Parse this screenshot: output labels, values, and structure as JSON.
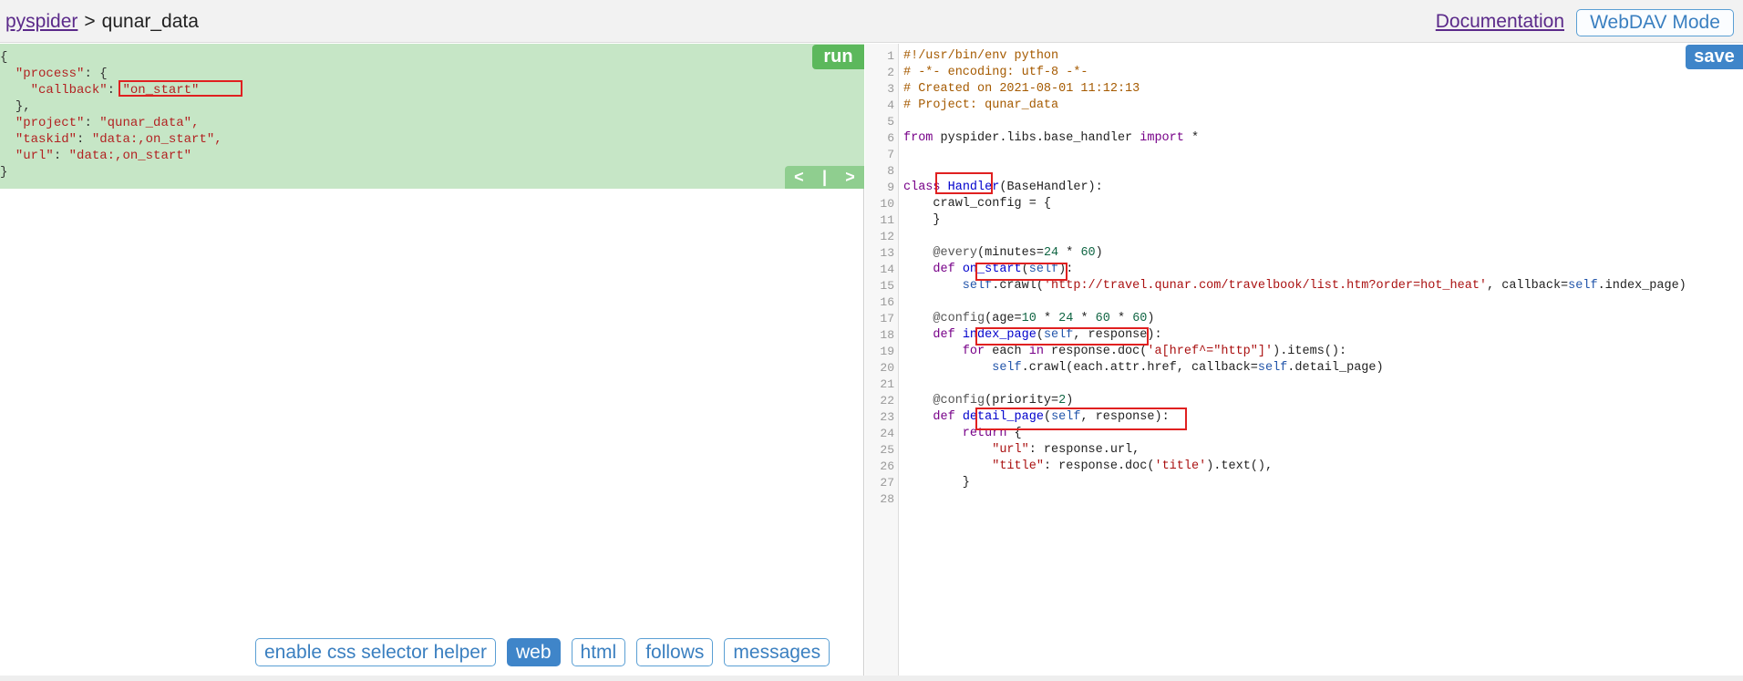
{
  "header": {
    "home_link": "pyspider",
    "separator": ">",
    "project_name": "qunar_data",
    "documentation_link": "Documentation",
    "webdav_button": "WebDAV Mode"
  },
  "task_panel": {
    "run_button": "run",
    "prev_label": "<",
    "divider_label": "|",
    "next_label": ">",
    "json": {
      "l1": "{",
      "l2_key": "\"process\"",
      "l2_rest": ": {",
      "l3_key": "\"callback\"",
      "l3_colon": ": ",
      "l3_value": "\"on_start\"",
      "l4": "},",
      "l5_key": "\"project\"",
      "l5_colon": ": ",
      "l5_value": "\"qunar_data\",",
      "l6_key": "\"taskid\"",
      "l6_colon": ": ",
      "l6_value": "\"data:,on_start\",",
      "l7_key": "\"url\"",
      "l7_colon": ": ",
      "l7_value": "\"data:,on_start\"",
      "l8": "}"
    }
  },
  "bottom_tabs": {
    "css_helper": "enable css selector helper",
    "web": "web",
    "html": "html",
    "follows": "follows",
    "messages": "messages"
  },
  "editor": {
    "save_button": "save",
    "line_numbers": [
      "1",
      "2",
      "3",
      "4",
      "5",
      "6",
      "7",
      "8",
      "9",
      "10",
      "11",
      "12",
      "13",
      "14",
      "15",
      "16",
      "17",
      "18",
      "19",
      "20",
      "21",
      "22",
      "23",
      "24",
      "25",
      "26",
      "27",
      "28"
    ],
    "code": {
      "l1": "#!/usr/bin/env python",
      "l2": "# -*- encoding: utf-8 -*-",
      "l3": "# Created on 2021-08-01 11:12:13",
      "l4": "# Project: qunar_data",
      "l6_from": "from",
      "l6_mod": " pyspider.libs.base_handler ",
      "l6_import": "import",
      "l6_star": " *",
      "l9_class": "class",
      "l9_name": "Handler",
      "l9_rest": "(BaseHandler):",
      "l10": "    crawl_config = {",
      "l11": "    }",
      "l13_dec": "    @every",
      "l13_a": "(minutes=",
      "l13_n1": "24",
      "l13_op": " * ",
      "l13_n2": "60",
      "l13_b": ")",
      "l14_def": "    def",
      "l14_name": "on_start",
      "l14_a": "(",
      "l14_self": "self",
      "l14_b": "):",
      "l15_self": "        self",
      "l15_a": ".crawl(",
      "l15_url": "'http://travel.qunar.com/travelbook/list.htm?order=hot_heat'",
      "l15_b": ", callback=",
      "l15_self2": "self",
      "l15_c": ".index_page)",
      "l17_dec": "    @config",
      "l17_a": "(age=",
      "l17_n1": "10",
      "l17_op1": " * ",
      "l17_n2": "24",
      "l17_op2": " * ",
      "l17_n3": "60",
      "l17_op3": " * ",
      "l17_n4": "60",
      "l17_b": ")",
      "l18_def": "    def",
      "l18_name": "index_page",
      "l18_a": "(",
      "l18_self": "self",
      "l18_b": ", response):",
      "l19_for": "        for",
      "l19_a": " each ",
      "l19_in": "in",
      "l19_b": " response.doc(",
      "l19_sel": "'a[href^=\"http\"]'",
      "l19_c": ").items():",
      "l20_self": "            self",
      "l20_a": ".crawl(each.attr.href, callback=",
      "l20_self2": "self",
      "l20_b": ".detail_page)",
      "l22_dec": "    @config",
      "l22_a": "(priority=",
      "l22_n": "2",
      "l22_b": ")",
      "l23_def": "    def",
      "l23_name": "detail_page",
      "l23_a": "(",
      "l23_self": "self",
      "l23_b": ", response):",
      "l24_ret": "        return",
      "l24_a": " {",
      "l25_key": "            \"url\"",
      "l25_a": ": response.url,",
      "l26_key": "            \"title\"",
      "l26_a": ": response.doc(",
      "l26_str": "'title'",
      "l26_b": ").text(),",
      "l27": "        }"
    }
  },
  "colors": {
    "task_background": "#c6e6c6",
    "run_button": "#5cb85c",
    "save_button": "#3f85c9",
    "highlight_box": "#e02020"
  }
}
